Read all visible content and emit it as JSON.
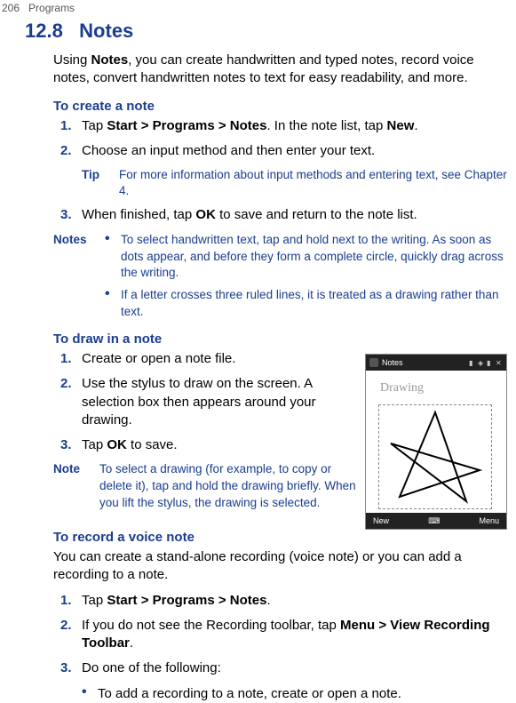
{
  "header": {
    "page_number": "206",
    "section_name": "Programs"
  },
  "section": {
    "number": "12.8",
    "title": "Notes"
  },
  "intro_parts": {
    "p1": "Using ",
    "b1": "Notes",
    "p2": ", you can create handwritten and typed notes, record voice notes, convert handwritten notes to text for easy readability, and more."
  },
  "create": {
    "heading": "To create a note",
    "step1": {
      "num": "1.",
      "t1": "Tap ",
      "b1": "Start > Programs > Notes",
      "t2": ". In the note list, tap ",
      "b2": "New",
      "t3": "."
    },
    "step2": {
      "num": "2.",
      "text": "Choose an input method and then enter your text."
    },
    "tip": {
      "label": "Tip",
      "text": "For more information about input methods and entering text, see Chapter 4."
    },
    "step3": {
      "num": "3.",
      "t1": "When finished, tap ",
      "b1": "OK",
      "t2": " to save and return to the note list."
    }
  },
  "notes_block": {
    "label": "Notes",
    "b1": "To select handwritten text, tap and hold next to the writing. As soon as dots appear, and before they form a complete circle, quickly drag across the writing.",
    "b2": "If a letter crosses three ruled lines, it is treated as a drawing rather than text."
  },
  "draw": {
    "heading": "To draw in a note",
    "step1": {
      "num": "1.",
      "text": "Create or open a note file."
    },
    "step2": {
      "num": "2.",
      "text": "Use the stylus to draw on the screen. A selection box then appears around your drawing."
    },
    "step3": {
      "num": "3.",
      "t1": "Tap ",
      "b1": "OK",
      "t2": " to save."
    },
    "note": {
      "label": "Note",
      "text": "To select a drawing (for example, to copy or delete it), tap and hold the drawing briefly. When you lift the stylus, the drawing is selected."
    }
  },
  "mock": {
    "app_title": "Notes",
    "drawing_label": "Drawing",
    "bottom_left": "New",
    "bottom_right": "Menu"
  },
  "record": {
    "heading": "To record a voice note",
    "intro": "You can create a stand-alone recording (voice note) or you can add a recording to a note.",
    "step1": {
      "num": "1.",
      "t1": "Tap ",
      "b1": "Start > Programs > Notes",
      "t2": "."
    },
    "step2": {
      "num": "2.",
      "t1": "If you do not see the Recording toolbar, tap ",
      "b1": "Menu > View Recording Toolbar",
      "t2": "."
    },
    "step3": {
      "num": "3.",
      "text": "Do one of the following:",
      "bullet1": "To add a recording to a note, create or open a note."
    }
  }
}
